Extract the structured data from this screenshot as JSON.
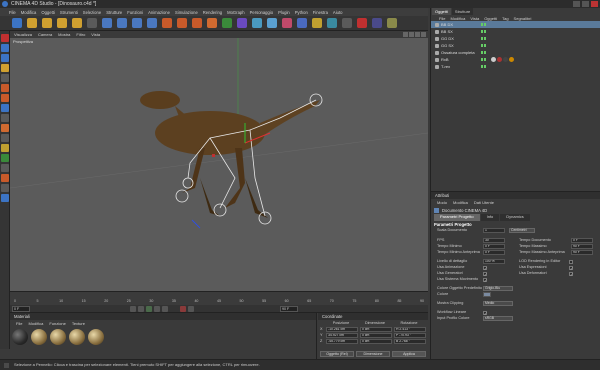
{
  "window": {
    "title": "CINEMA 4D Studio - [Dinosauro.c4d *]"
  },
  "menubar": [
    "File",
    "Modifica",
    "Oggetti",
    "Strumenti",
    "Selezione",
    "Strutture",
    "Funzioni",
    "Animazione",
    "Simulazione",
    "Rendering",
    "MoGraph",
    "Personaggio",
    "Plugin",
    "Python",
    "Finestra",
    "Aiuto"
  ],
  "viewport": {
    "menu": [
      "Visualizza",
      "Camera",
      "Mostra",
      "Filtro",
      "Vista"
    ],
    "label": "Prospettiva"
  },
  "timeline": {
    "ticks": [
      "0",
      "5",
      "10",
      "15",
      "20",
      "25",
      "30",
      "35",
      "40",
      "45",
      "50",
      "55",
      "60",
      "65",
      "70",
      "75",
      "80",
      "85",
      "90"
    ],
    "current_frame": "0 F",
    "end_frame": "90 F"
  },
  "materials": {
    "title": "Materiali",
    "menu": [
      "File",
      "Modifica",
      "Funzione",
      "Texture"
    ],
    "ball_count": 5
  },
  "coords": {
    "title": "Coordinate",
    "headers": [
      "Posizione",
      "Dimensione",
      "Rotazione"
    ],
    "rows": [
      {
        "axis": "X",
        "pos": "-10.261 cm",
        "dim": "0 cm",
        "rot": "H 2.413 °"
      },
      {
        "axis": "Y",
        "pos": "34.927 cm",
        "dim": "0 cm",
        "rot": "P -70.93 °"
      },
      {
        "axis": "Z",
        "pos": "-45.779 cm",
        "dim": "0 cm",
        "rot": "B 2.768 °"
      }
    ],
    "buttons": [
      "Oggetto (Rel)",
      "Dimensione",
      "Applica"
    ]
  },
  "objmgr": {
    "tabs": [
      "Oggetti",
      "Strutture"
    ],
    "menu": [
      "File",
      "Modifica",
      "Vista",
      "Oggetti",
      "Tag",
      "Segnalibri"
    ],
    "objects": [
      {
        "name": "BB DX",
        "selected": true,
        "indent": 0
      },
      {
        "name": "BB SX",
        "selected": false,
        "indent": 0
      },
      {
        "name": "GG DX",
        "selected": false,
        "indent": 0
      },
      {
        "name": "GG SX",
        "selected": false,
        "indent": 0
      },
      {
        "name": "Ossatura completa",
        "selected": false,
        "indent": 0
      },
      {
        "name": "RxB",
        "selected": false,
        "indent": 0
      },
      {
        "name": "T-rex",
        "selected": false,
        "indent": 0
      }
    ]
  },
  "attr": {
    "title": "Attributi",
    "menu": [
      "Modo",
      "Modifica",
      "Dati Utente"
    ],
    "document": "Documento CINEMA 4D",
    "tabs": [
      "Parametri Progetto",
      "Info",
      "Dynamics"
    ],
    "section": "Parametri Progetto",
    "scale_label": "Scala Documento",
    "scale_val": "1",
    "scale_unit": "Centimetri",
    "fps_label": "FPS",
    "fps_val": "30",
    "min_label": "Tempo Minimo",
    "min_val": "0 F",
    "minprev_label": "Tempo Minimo Anteprima",
    "minprev_val": "0 F",
    "doc_label": "Tempo Documento",
    "doc_val": "0 F",
    "max_label": "Tempo Massimo",
    "max_val": "90 F",
    "maxprev_label": "Tempo Massimo Anteprima",
    "maxprev_val": "90 F",
    "lod_label": "Livello di dettaglio",
    "lod_val": "100 %",
    "lodr_label": "LOD Rendering in Editor",
    "anim_label": "Usa Animazione",
    "expr_label": "Usa Espressioni",
    "gen_label": "Usa Generatori",
    "def_label": "Usa Deformatori",
    "motion_label": "Usa Sistema Movimento",
    "colclip_label": "Colore Oggetto Predefinito",
    "colclip_val": "Grigio-Blu",
    "color_label": "Colore",
    "clip_label": "Mostra Clipping",
    "clip_val": "Medio",
    "linear_label": "Workflow Lineare",
    "profile_label": "Input Profilo Colore",
    "profile_val": "sRGB"
  },
  "status": "Selezione a Pennello: Clicca e trascina per selezionare elementi. Tieni premuto SHIFT per aggiungere alla selezione, CTRL per rimuovere."
}
